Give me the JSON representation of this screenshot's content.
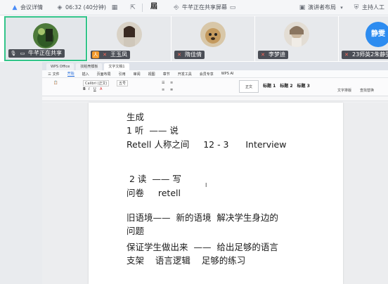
{
  "topbar": {
    "app_label": "会议详情",
    "time": "06:32 (40分钟)",
    "sharing_text": "牛芊正在共享屏幕",
    "speaker_layout": "演讲者布局",
    "host_label": "主持人工"
  },
  "participants": [
    {
      "name": "牛芊正在共享"
    },
    {
      "name": "王玉凤"
    },
    {
      "name": "隋佳倩"
    },
    {
      "name": "李梦迪"
    },
    {
      "name": "23师英2朱静雯",
      "avatar_text": "静雯"
    }
  ],
  "wps": {
    "tabs": [
      "WPS Office",
      "找稻壳模板",
      "文字文稿1"
    ],
    "menu": [
      "三 文件",
      "开始",
      "插入",
      "页面布局",
      "引用",
      "审阅",
      "视图",
      "章节",
      "开发工具",
      "会员专享",
      "WPS AI"
    ],
    "font_name": "Calibri (正文)",
    "font_size": "五号",
    "styles": [
      "正文",
      "标题 1",
      "标题 2",
      "标题 3"
    ],
    "ribbon_right": [
      "文字排版",
      "查找替换"
    ]
  },
  "document": {
    "lines": [
      "生成",
      "1 听  —— 说",
      "Retell 人称之间     12 - 3      Interview",
      "",
      " 2 读  —— 写",
      "问卷     retell",
      "旧语境——  新的语境  解决学生身边的",
      "问题",
      "保证学生做出来  ——  给出足够的语言",
      "支架    语言逻辑    足够的练习"
    ]
  },
  "colors": {
    "active_border": "#33c48a",
    "accent_blue": "#1a64d8"
  }
}
